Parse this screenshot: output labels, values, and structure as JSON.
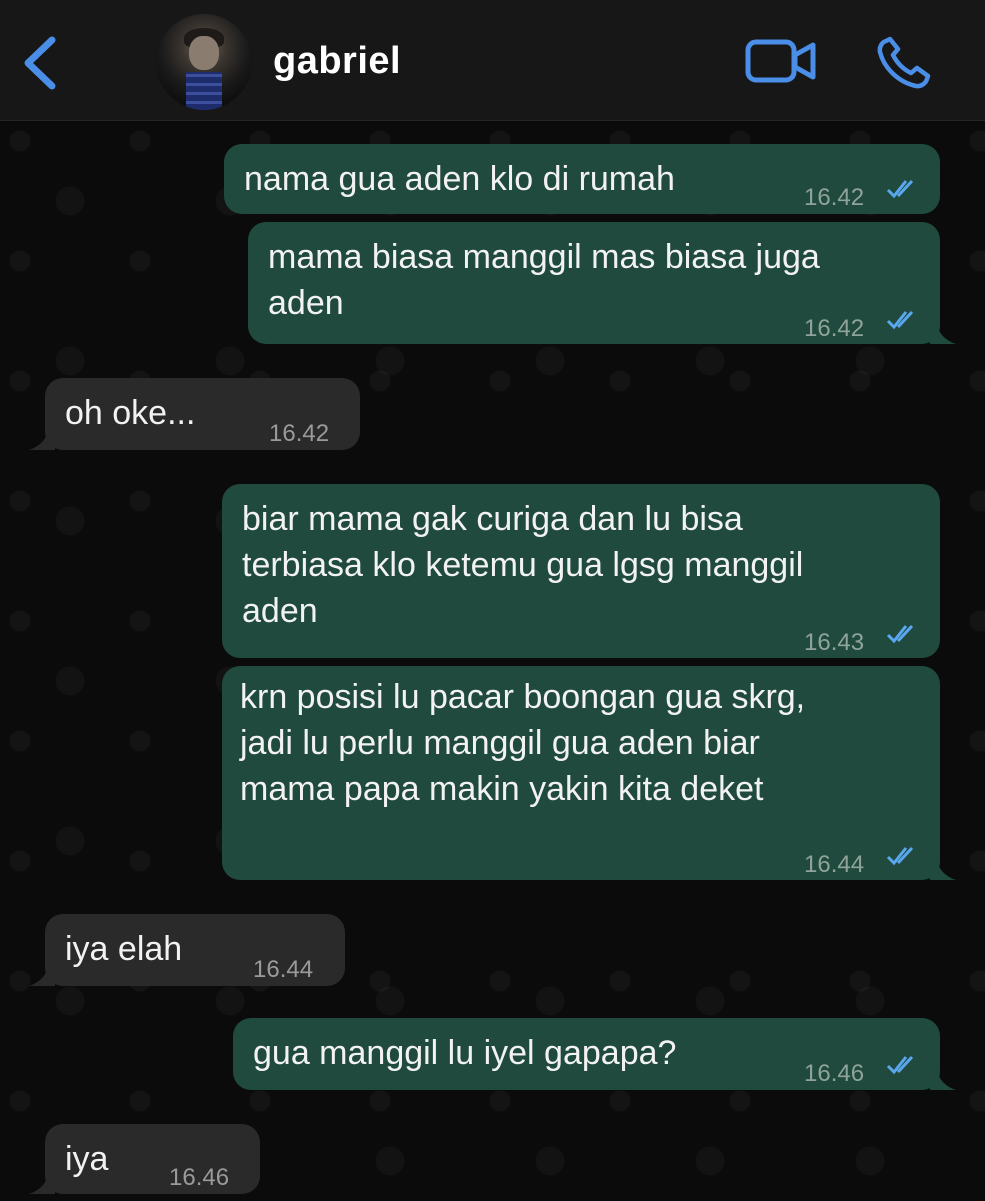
{
  "header": {
    "contact_name": "gabriel",
    "back_icon": "chevron-left-icon",
    "video_icon": "video-call-icon",
    "call_icon": "phone-icon",
    "accent": "#4a8ee8"
  },
  "colors": {
    "outgoing_bubble": "#1f4a3d",
    "incoming_bubble": "#2a2a2a",
    "read_ticks": "#5aa7ee"
  },
  "messages": [
    {
      "dir": "out",
      "text": "nama gua aden klo di rumah",
      "time": "16.42",
      "status": "read"
    },
    {
      "dir": "out",
      "text": "mama biasa manggil mas biasa juga\naden",
      "time": "16.42",
      "status": "read"
    },
    {
      "dir": "in",
      "text": "oh oke...",
      "time": "16.42"
    },
    {
      "dir": "out",
      "text": "biar mama gak curiga dan lu bisa\nterbiasa klo ketemu gua lgsg manggil\naden",
      "time": "16.43",
      "status": "read"
    },
    {
      "dir": "out",
      "text": "krn posisi lu pacar boongan gua skrg,\njadi lu perlu manggil gua aden biar\nmama papa makin yakin kita deket",
      "time": "16.44",
      "status": "read"
    },
    {
      "dir": "in",
      "text": "iya elah",
      "time": "16.44"
    },
    {
      "dir": "out",
      "text": "gua manggil lu iyel gapapa?",
      "time": "16.46",
      "status": "read"
    },
    {
      "dir": "in",
      "text": "iya",
      "time": "16.46"
    }
  ]
}
